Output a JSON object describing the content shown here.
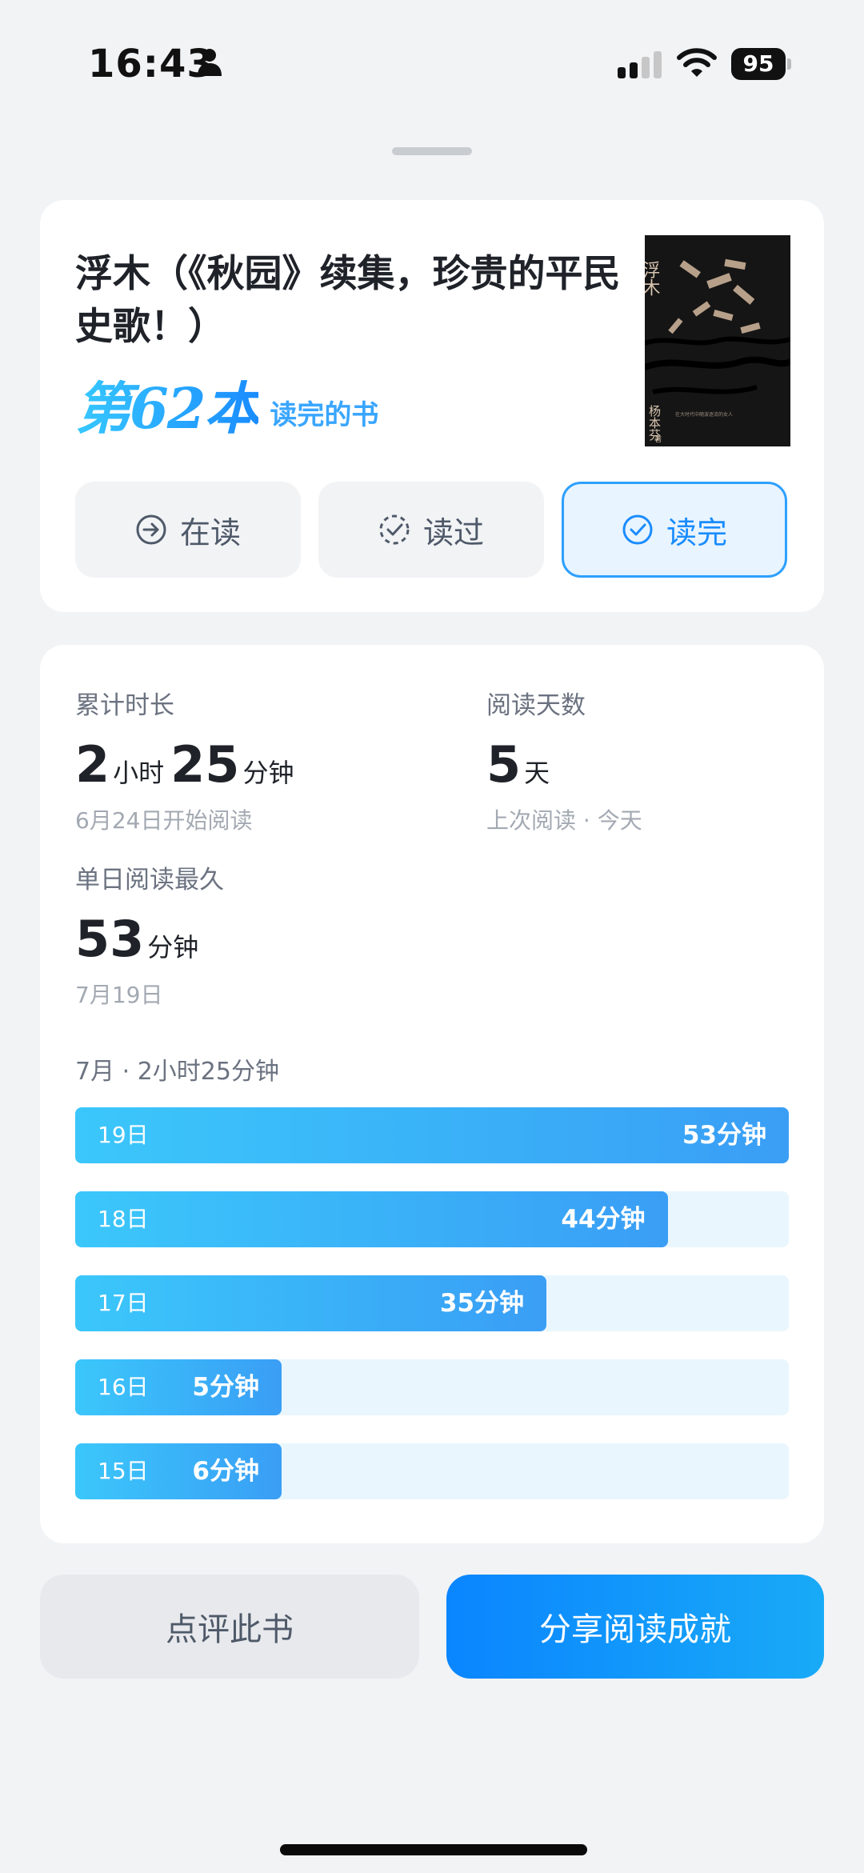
{
  "status_bar": {
    "time": "16:43",
    "battery": "95"
  },
  "book": {
    "title": "浮木（《秋园》续集，珍贵的平民史歌！）",
    "count_label": "第62本",
    "count_suffix": "读完的书",
    "cover": {
      "title": "浮木",
      "author": "杨本芬",
      "author_mark": "著",
      "subtitle": "在大时代中随波逐流的女人"
    }
  },
  "status_buttons": [
    {
      "label": "在读",
      "icon": "arrow-circle-icon",
      "active": false
    },
    {
      "label": "读过",
      "icon": "dashed-check-circle-icon",
      "active": false
    },
    {
      "label": "读完",
      "icon": "check-circle-icon",
      "active": true
    }
  ],
  "stats": {
    "total": {
      "label": "累计时长",
      "hours": "2",
      "hours_unit": "小时",
      "minutes": "25",
      "minutes_unit": "分钟",
      "sub": "6月24日开始阅读"
    },
    "days": {
      "label": "阅读天数",
      "value": "5",
      "unit": "天",
      "sub": "上次阅读 · 今天"
    },
    "longest": {
      "label": "单日阅读最久",
      "value": "53",
      "unit": "分钟",
      "sub": "7月19日"
    }
  },
  "month_summary": "7月 · 2小时25分钟",
  "daily": [
    {
      "day": "19日",
      "minutes": 53,
      "label": "53分钟"
    },
    {
      "day": "18日",
      "minutes": 44,
      "label": "44分钟"
    },
    {
      "day": "17日",
      "minutes": 35,
      "label": "35分钟"
    },
    {
      "day": "16日",
      "minutes": 5,
      "label": "5分钟"
    },
    {
      "day": "15日",
      "minutes": 6,
      "label": "6分钟"
    }
  ],
  "actions": {
    "review": "点评此书",
    "share": "分享阅读成就"
  },
  "colors": {
    "accent": "#1a8cff",
    "bar_start": "#3bc7fb",
    "bar_end": "#3a9ef5",
    "bar_track": "#e9f6fe"
  }
}
